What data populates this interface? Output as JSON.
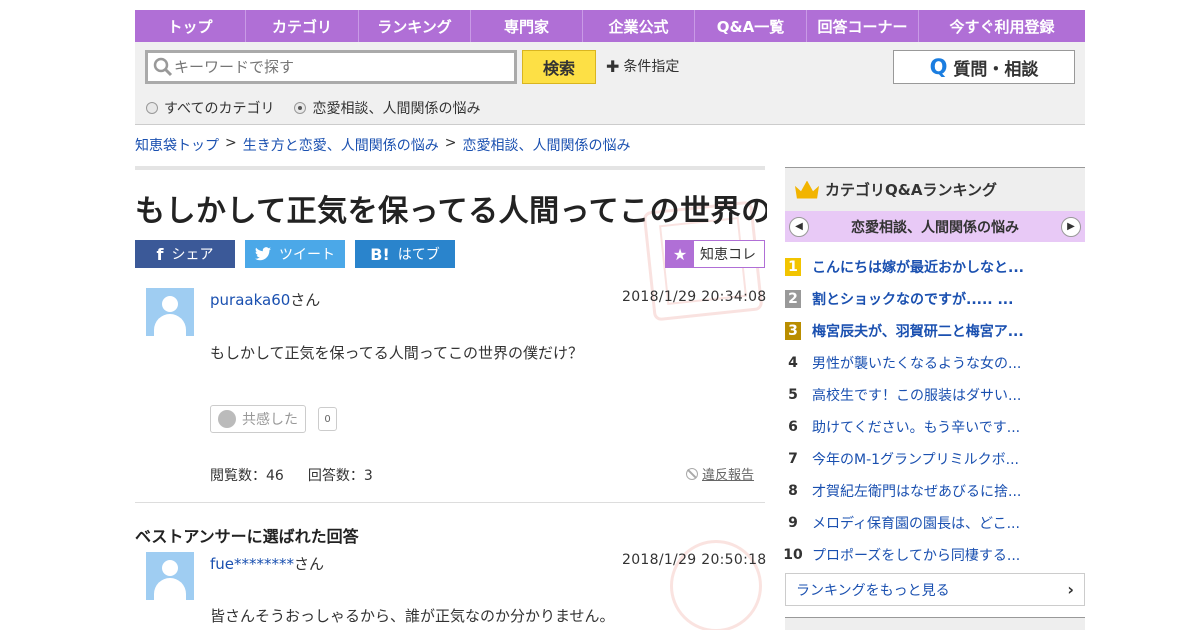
{
  "nav": [
    "トップ",
    "カテゴリ",
    "ランキング",
    "専門家",
    "企業公式",
    "Q&A一覧",
    "回答コーナー",
    "今すぐ利用登録"
  ],
  "search": {
    "placeholder": "キーワードで探す",
    "button": "検索",
    "conditions": "条件指定",
    "ask_button": "質問・相談",
    "radio_all": "すべてのカテゴリ",
    "radio_cat": "恋愛相談、人間関係の悩み"
  },
  "breadcrumb": [
    "知恵袋トップ",
    "生き方と恋愛、人間関係の悩み",
    "恋愛相談、人間関係の悩み"
  ],
  "question": {
    "title": "もしかして正気を保ってる人間ってこの世界の...",
    "user": "puraaka60",
    "user_suffix": "さん",
    "date": "2018/1/29  20:34:08",
    "body": "もしかして正気を保ってる人間ってこの世界の僕だけ？",
    "empathy_label": "共感した",
    "empathy_count": "0",
    "views": "閲覧数：46",
    "answers": "回答数：3",
    "report": "違反報告"
  },
  "share": {
    "facebook": "シェア",
    "twitter": "ツイート",
    "hatena": "はてブ",
    "chie_collection": "知恵コレ"
  },
  "best_answer": {
    "label": "ベストアンサーに選ばれた回答",
    "user": "fue********",
    "user_suffix": "さん",
    "date": "2018/1/29  20:50:18",
    "body": "皆さんそうおっしゃるから、誰が正気なのか分かりません。"
  },
  "ranking": {
    "title": "カテゴリQ&Aランキング",
    "category": "恋愛相談、人間関係の悩み",
    "items": [
      {
        "rank": "1",
        "text": "こんにちは嫁が最近おかしなと..."
      },
      {
        "rank": "2",
        "text": "割とショックなのですが..... ..."
      },
      {
        "rank": "3",
        "text": "梅宮辰夫が、羽賀研二と梅宮ア..."
      },
      {
        "rank": "4",
        "text": "男性が襲いたくなるような女の..."
      },
      {
        "rank": "5",
        "text": "高校生です！この服装はダサい..."
      },
      {
        "rank": "6",
        "text": "助けてください。もう辛いです..."
      },
      {
        "rank": "7",
        "text": "今年のM-1グランプリミルクボ..."
      },
      {
        "rank": "8",
        "text": "才賀紀左衛門はなぜあびるに捨..."
      },
      {
        "rank": "9",
        "text": "メロディ保育園の園長は、どこ..."
      },
      {
        "rank": "10",
        "text": "プロポーズをしてから同棲する..."
      }
    ],
    "more": "ランキングをもっと見る"
  },
  "colors": {
    "nav": "#b06fd6",
    "search_button": "#fde045",
    "link": "#1a50b0"
  }
}
